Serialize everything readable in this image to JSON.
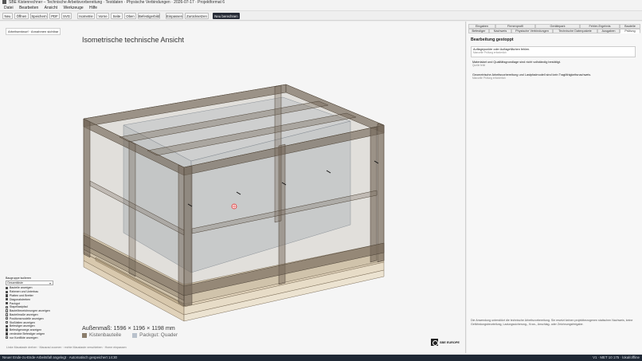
{
  "window": {
    "title": "SBE Kistenrechner – Technische Arbeitsvorbereitung · Testdaten · Physische Verbindungen · 2026-07-17 · Projektformat 6"
  },
  "menu": [
    "Datei",
    "Bearbeiten",
    "Ansicht",
    "Werkzeuge",
    "Hilfe"
  ],
  "toolbar": {
    "buttons": [
      "Neu",
      "Öffnen",
      "Speichern",
      "PDF",
      "SVG",
      "Isometrie",
      "Vorne",
      "Seite",
      "Oben",
      "Befestigerbild",
      "Einpassen",
      "Zurücksetzen"
    ],
    "primary": "Neu berechnen"
  },
  "canvas": {
    "hint_chip": "Arbeitsentwurf · Annahmen sichtbar",
    "view_title": "Isometrische technische Ansicht",
    "dimensions": "Außenmaß: 1596 × 1196 × 1198 mm",
    "legend": [
      "Kistenbauteile",
      "Packgut: Quader"
    ],
    "status_hint": "Linke Maustaste drehen · Mausrad zoomen · rechte Maustaste verschieben · Home einpassen",
    "logo_text": "SBE EUROPE"
  },
  "groups": {
    "header": "Baugruppe isolieren",
    "select_value": "Gesamtkiste",
    "items": [
      {
        "label": "Bauteile anzeigen",
        "checked": true
      },
      {
        "label": "Rahmen und Unterbau",
        "checked": true
      },
      {
        "label": "Platten und Bretter",
        "checked": true
      },
      {
        "label": "Diagonalstreben",
        "checked": true
      },
      {
        "label": "Packgut",
        "checked": true
      },
      {
        "label": "Stapellastpfad",
        "checked": false
      },
      {
        "label": "Bauteilbezeichnungen anzeigen",
        "checked": false
      },
      {
        "label": "Bauteilmaße anzeigen",
        "checked": false
      },
      {
        "label": "Positionsmodelle anzeigen",
        "checked": false
      },
      {
        "label": "Stoßfalten anzeigen",
        "checked": false
      },
      {
        "label": "Befestiger anzeigen",
        "checked": true
      },
      {
        "label": "Befestigerwege anzeigen",
        "checked": true
      },
      {
        "label": "verdeckte Befestiger zeigen",
        "checked": true
      },
      {
        "label": "nur Konflikte anzeigen",
        "checked": false
      }
    ]
  },
  "panel": {
    "tabs_row1": [
      "Eingaben",
      "Firmenprofil",
      "Gerätepark",
      "Fehler-Ergebnis",
      "Bauteile",
      "Zuschnitt"
    ],
    "tabs_row2": [
      "Befestiger",
      "Nachweis",
      "Physische Verbindungen",
      "Technische Datenpakete",
      "Ausgaben",
      "Prüfung"
    ],
    "active_tab": "Prüfung",
    "title": "Bearbeitung gestoppt",
    "cards": [
      {
        "text": "Auflagepunkte oder Auflageflächen fehlen.",
        "sub": "Manuelle Prüfung erforderlich"
      },
      {
        "text": "Materialart und Qualitätsgrundlage sind nicht vollständig bestätigt.",
        "sub": "Quelle fehlt"
      },
      {
        "text": "Geometrische Arbeitsvorbereitung und Lastpfadmodell sind kein Tragfähigkeitsnachweis.",
        "sub": "Manuelle Prüfung erforderlich"
      }
    ],
    "note": "Die Anwendung unterstützt die technische Arbeitsvorbereitung. Sie ersetzt keinen projektbezogenen statischen Nachweis, keine Gefährdungsbeurteilung, Ladungssicherung-, Kran-, Anschlag- oder Zeichnungsfreigabe."
  },
  "status": {
    "left": "Neuer Ende-zu-Ende-Arbeitsfall angelegt · Automatisch gespeichert 14:30",
    "right": "V1 · MET 10 175 · lokal/offline"
  },
  "colors": {
    "frame": "#6f6250",
    "frame_fill": "#8a7d6b",
    "pallet": "#d8c6a6",
    "packgut": "#b9c2cc",
    "primary": "#262b36"
  }
}
